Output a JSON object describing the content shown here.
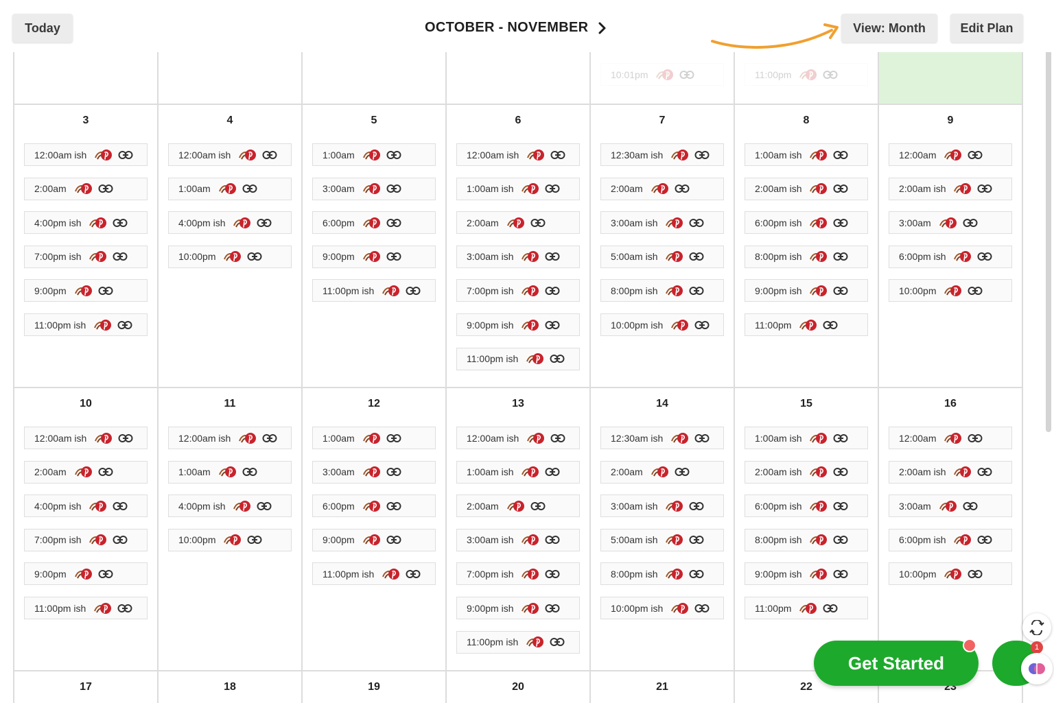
{
  "toolbar": {
    "today_label": "Today",
    "title": "OCTOBER - NOVEMBER",
    "view_label": "View: Month",
    "edit_label": "Edit Plan"
  },
  "colors": {
    "accent_orange": "#f0a030",
    "cta_green": "#1daa2c",
    "highlight_green": "#dff3da",
    "pinterest_red": "#c8232c"
  },
  "icons": {
    "next": "chevron-right-icon",
    "pin": "pinterest-icon",
    "link": "link-icon"
  },
  "calendar": {
    "partial_week": [
      {
        "day": "",
        "slots": []
      },
      {
        "day": "",
        "slots": []
      },
      {
        "day": "",
        "slots": []
      },
      {
        "day": "",
        "slots": []
      },
      {
        "day": "",
        "slots": [
          "10:01pm"
        ]
      },
      {
        "day": "",
        "slots": [
          "11:00pm"
        ]
      },
      {
        "day": "",
        "slots": [],
        "highlight": true
      }
    ],
    "weeks": [
      [
        {
          "day": "3",
          "slots": [
            "12:00am ish",
            "2:00am",
            "4:00pm ish",
            "7:00pm ish",
            "9:00pm",
            "11:00pm ish"
          ]
        },
        {
          "day": "4",
          "slots": [
            "12:00am ish",
            "1:00am",
            "4:00pm ish",
            "10:00pm"
          ]
        },
        {
          "day": "5",
          "slots": [
            "1:00am",
            "3:00am",
            "6:00pm",
            "9:00pm",
            "11:00pm ish"
          ]
        },
        {
          "day": "6",
          "slots": [
            "12:00am ish",
            "1:00am ish",
            "2:00am",
            "3:00am ish",
            "7:00pm ish",
            "9:00pm ish",
            "11:00pm ish"
          ]
        },
        {
          "day": "7",
          "slots": [
            "12:30am ish",
            "2:00am",
            "3:00am ish",
            "5:00am ish",
            "8:00pm ish",
            "10:00pm ish"
          ]
        },
        {
          "day": "8",
          "slots": [
            "1:00am ish",
            "2:00am ish",
            "6:00pm ish",
            "8:00pm ish",
            "9:00pm ish",
            "11:00pm"
          ]
        },
        {
          "day": "9",
          "slots": [
            "12:00am",
            "2:00am ish",
            "3:00am",
            "6:00pm ish",
            "10:00pm"
          ]
        }
      ],
      [
        {
          "day": "10",
          "slots": [
            "12:00am ish",
            "2:00am",
            "4:00pm ish",
            "7:00pm ish",
            "9:00pm",
            "11:00pm ish"
          ]
        },
        {
          "day": "11",
          "slots": [
            "12:00am ish",
            "1:00am",
            "4:00pm ish",
            "10:00pm"
          ]
        },
        {
          "day": "12",
          "slots": [
            "1:00am",
            "3:00am",
            "6:00pm",
            "9:00pm",
            "11:00pm ish"
          ]
        },
        {
          "day": "13",
          "slots": [
            "12:00am ish",
            "1:00am ish",
            "2:00am",
            "3:00am ish",
            "7:00pm ish",
            "9:00pm ish",
            "11:00pm ish"
          ]
        },
        {
          "day": "14",
          "slots": [
            "12:30am ish",
            "2:00am",
            "3:00am ish",
            "5:00am ish",
            "8:00pm ish",
            "10:00pm ish"
          ]
        },
        {
          "day": "15",
          "slots": [
            "1:00am ish",
            "2:00am ish",
            "6:00pm ish",
            "8:00pm ish",
            "9:00pm ish",
            "11:00pm"
          ]
        },
        {
          "day": "16",
          "slots": [
            "12:00am",
            "2:00am ish",
            "3:00am",
            "6:00pm ish",
            "10:00pm"
          ]
        }
      ],
      [
        {
          "day": "17",
          "slots": []
        },
        {
          "day": "18",
          "slots": []
        },
        {
          "day": "19",
          "slots": []
        },
        {
          "day": "20",
          "slots": []
        },
        {
          "day": "21",
          "slots": []
        },
        {
          "day": "22",
          "slots": []
        },
        {
          "day": "23",
          "slots": []
        }
      ]
    ]
  },
  "cta": {
    "label": "Get Started",
    "chat_badge": "1"
  }
}
